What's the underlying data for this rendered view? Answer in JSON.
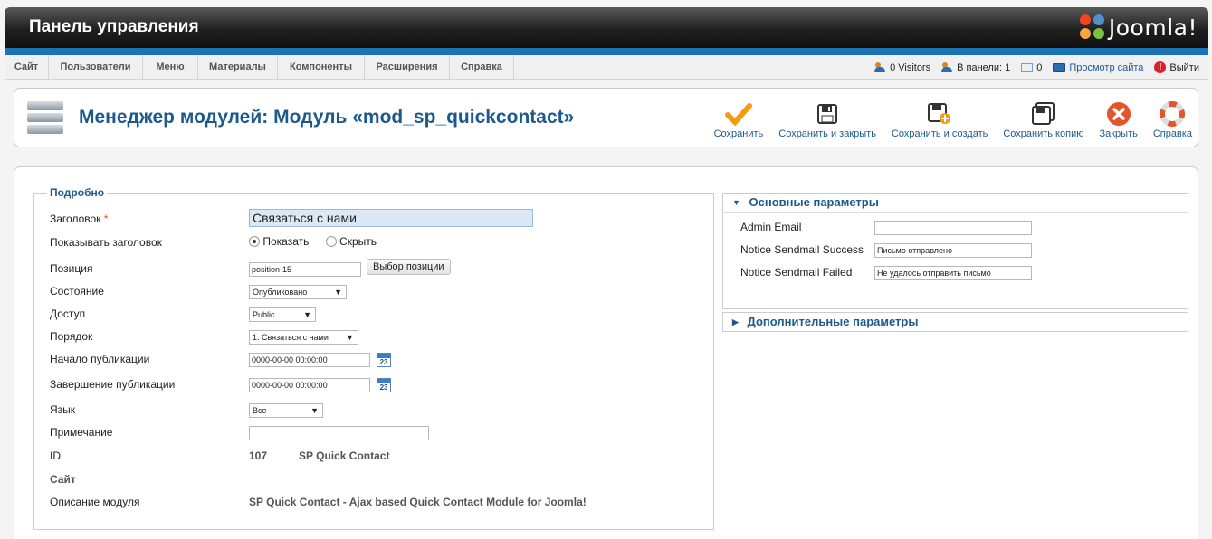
{
  "header": {
    "title": "Панель управления",
    "logo_text": "Joomla!"
  },
  "menu": {
    "items": [
      "Сайт",
      "Пользователи",
      "Меню",
      "Материалы",
      "Компоненты",
      "Расширения",
      "Справка"
    ]
  },
  "status": {
    "visitors": "0 Visitors",
    "admins": "В панели: 1",
    "messages": "0",
    "view_site": "Просмотр сайта",
    "logout": "Выйти"
  },
  "page": {
    "title": "Менеджер модулей: Модуль «mod_sp_quickcontact»"
  },
  "toolbar": {
    "save": "Сохранить",
    "save_close": "Сохранить и закрыть",
    "save_new": "Сохранить и создать",
    "save_copy": "Сохранить копию",
    "close": "Закрыть",
    "help": "Справка"
  },
  "details": {
    "legend": "Подробно",
    "title_label": "Заголовок",
    "title_required": "*",
    "title_value": "Связаться с нами",
    "show_title_label": "Показывать заголовок",
    "show_option": "Показать",
    "hide_option": "Скрыть",
    "position_label": "Позиция",
    "position_value": "position-15",
    "position_button": "Выбор позиции",
    "state_label": "Состояние",
    "state_value": "Опубликовано",
    "access_label": "Доступ",
    "access_value": "Public",
    "order_label": "Порядок",
    "order_value": "1. Связаться с нами",
    "publish_up_label": "Начало публикации",
    "publish_up_value": "0000-00-00 00:00:00",
    "publish_down_label": "Завершение публикации",
    "publish_down_value": "0000-00-00 00:00:00",
    "calendar_day": "23",
    "language_label": "Язык",
    "language_value": "Все",
    "note_label": "Примечание",
    "note_value": "",
    "id_label": "ID",
    "id_value": "107",
    "id_name": "SP Quick Contact",
    "site_label": "Сайт",
    "desc_label": "Описание модуля",
    "desc_value": "SP Quick Contact - Ajax based Quick Contact Module for Joomla!"
  },
  "basic_params": {
    "title": "Основные параметры",
    "admin_email_label": "Admin Email",
    "admin_email_value": "",
    "success_label": "Notice Sendmail Success",
    "success_value": "Письмо отправлено",
    "failed_label": "Notice Sendmail Failed",
    "failed_value": "Не удалось отправить письмо"
  },
  "extra_params": {
    "title": "Дополнительные параметры"
  },
  "colors": {
    "accent": "#1c5a8d",
    "header_bar": "#1a74b6",
    "save_orange": "#f39c12",
    "close_red": "#e4552b"
  }
}
